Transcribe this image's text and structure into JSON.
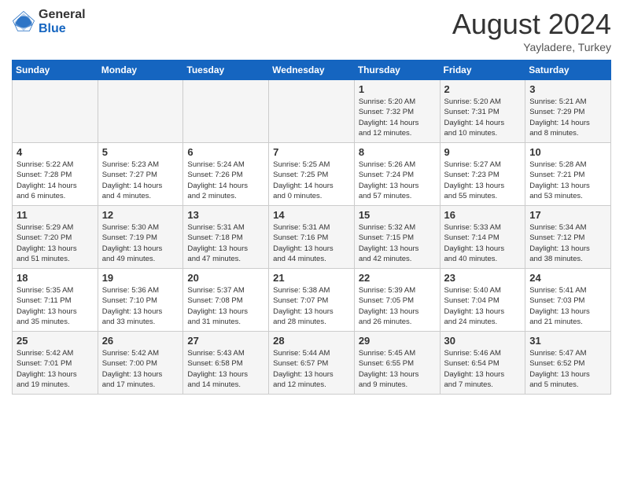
{
  "logo": {
    "general": "General",
    "blue": "Blue"
  },
  "title": "August 2024",
  "subtitle": "Yayladere, Turkey",
  "days_of_week": [
    "Sunday",
    "Monday",
    "Tuesday",
    "Wednesday",
    "Thursday",
    "Friday",
    "Saturday"
  ],
  "weeks": [
    [
      {
        "day": "",
        "info": ""
      },
      {
        "day": "",
        "info": ""
      },
      {
        "day": "",
        "info": ""
      },
      {
        "day": "",
        "info": ""
      },
      {
        "day": "1",
        "info": "Sunrise: 5:20 AM\nSunset: 7:32 PM\nDaylight: 14 hours\nand 12 minutes."
      },
      {
        "day": "2",
        "info": "Sunrise: 5:20 AM\nSunset: 7:31 PM\nDaylight: 14 hours\nand 10 minutes."
      },
      {
        "day": "3",
        "info": "Sunrise: 5:21 AM\nSunset: 7:29 PM\nDaylight: 14 hours\nand 8 minutes."
      }
    ],
    [
      {
        "day": "4",
        "info": "Sunrise: 5:22 AM\nSunset: 7:28 PM\nDaylight: 14 hours\nand 6 minutes."
      },
      {
        "day": "5",
        "info": "Sunrise: 5:23 AM\nSunset: 7:27 PM\nDaylight: 14 hours\nand 4 minutes."
      },
      {
        "day": "6",
        "info": "Sunrise: 5:24 AM\nSunset: 7:26 PM\nDaylight: 14 hours\nand 2 minutes."
      },
      {
        "day": "7",
        "info": "Sunrise: 5:25 AM\nSunset: 7:25 PM\nDaylight: 14 hours\nand 0 minutes."
      },
      {
        "day": "8",
        "info": "Sunrise: 5:26 AM\nSunset: 7:24 PM\nDaylight: 13 hours\nand 57 minutes."
      },
      {
        "day": "9",
        "info": "Sunrise: 5:27 AM\nSunset: 7:23 PM\nDaylight: 13 hours\nand 55 minutes."
      },
      {
        "day": "10",
        "info": "Sunrise: 5:28 AM\nSunset: 7:21 PM\nDaylight: 13 hours\nand 53 minutes."
      }
    ],
    [
      {
        "day": "11",
        "info": "Sunrise: 5:29 AM\nSunset: 7:20 PM\nDaylight: 13 hours\nand 51 minutes."
      },
      {
        "day": "12",
        "info": "Sunrise: 5:30 AM\nSunset: 7:19 PM\nDaylight: 13 hours\nand 49 minutes."
      },
      {
        "day": "13",
        "info": "Sunrise: 5:31 AM\nSunset: 7:18 PM\nDaylight: 13 hours\nand 47 minutes."
      },
      {
        "day": "14",
        "info": "Sunrise: 5:31 AM\nSunset: 7:16 PM\nDaylight: 13 hours\nand 44 minutes."
      },
      {
        "day": "15",
        "info": "Sunrise: 5:32 AM\nSunset: 7:15 PM\nDaylight: 13 hours\nand 42 minutes."
      },
      {
        "day": "16",
        "info": "Sunrise: 5:33 AM\nSunset: 7:14 PM\nDaylight: 13 hours\nand 40 minutes."
      },
      {
        "day": "17",
        "info": "Sunrise: 5:34 AM\nSunset: 7:12 PM\nDaylight: 13 hours\nand 38 minutes."
      }
    ],
    [
      {
        "day": "18",
        "info": "Sunrise: 5:35 AM\nSunset: 7:11 PM\nDaylight: 13 hours\nand 35 minutes."
      },
      {
        "day": "19",
        "info": "Sunrise: 5:36 AM\nSunset: 7:10 PM\nDaylight: 13 hours\nand 33 minutes."
      },
      {
        "day": "20",
        "info": "Sunrise: 5:37 AM\nSunset: 7:08 PM\nDaylight: 13 hours\nand 31 minutes."
      },
      {
        "day": "21",
        "info": "Sunrise: 5:38 AM\nSunset: 7:07 PM\nDaylight: 13 hours\nand 28 minutes."
      },
      {
        "day": "22",
        "info": "Sunrise: 5:39 AM\nSunset: 7:05 PM\nDaylight: 13 hours\nand 26 minutes."
      },
      {
        "day": "23",
        "info": "Sunrise: 5:40 AM\nSunset: 7:04 PM\nDaylight: 13 hours\nand 24 minutes."
      },
      {
        "day": "24",
        "info": "Sunrise: 5:41 AM\nSunset: 7:03 PM\nDaylight: 13 hours\nand 21 minutes."
      }
    ],
    [
      {
        "day": "25",
        "info": "Sunrise: 5:42 AM\nSunset: 7:01 PM\nDaylight: 13 hours\nand 19 minutes."
      },
      {
        "day": "26",
        "info": "Sunrise: 5:42 AM\nSunset: 7:00 PM\nDaylight: 13 hours\nand 17 minutes."
      },
      {
        "day": "27",
        "info": "Sunrise: 5:43 AM\nSunset: 6:58 PM\nDaylight: 13 hours\nand 14 minutes."
      },
      {
        "day": "28",
        "info": "Sunrise: 5:44 AM\nSunset: 6:57 PM\nDaylight: 13 hours\nand 12 minutes."
      },
      {
        "day": "29",
        "info": "Sunrise: 5:45 AM\nSunset: 6:55 PM\nDaylight: 13 hours\nand 9 minutes."
      },
      {
        "day": "30",
        "info": "Sunrise: 5:46 AM\nSunset: 6:54 PM\nDaylight: 13 hours\nand 7 minutes."
      },
      {
        "day": "31",
        "info": "Sunrise: 5:47 AM\nSunset: 6:52 PM\nDaylight: 13 hours\nand 5 minutes."
      }
    ]
  ]
}
